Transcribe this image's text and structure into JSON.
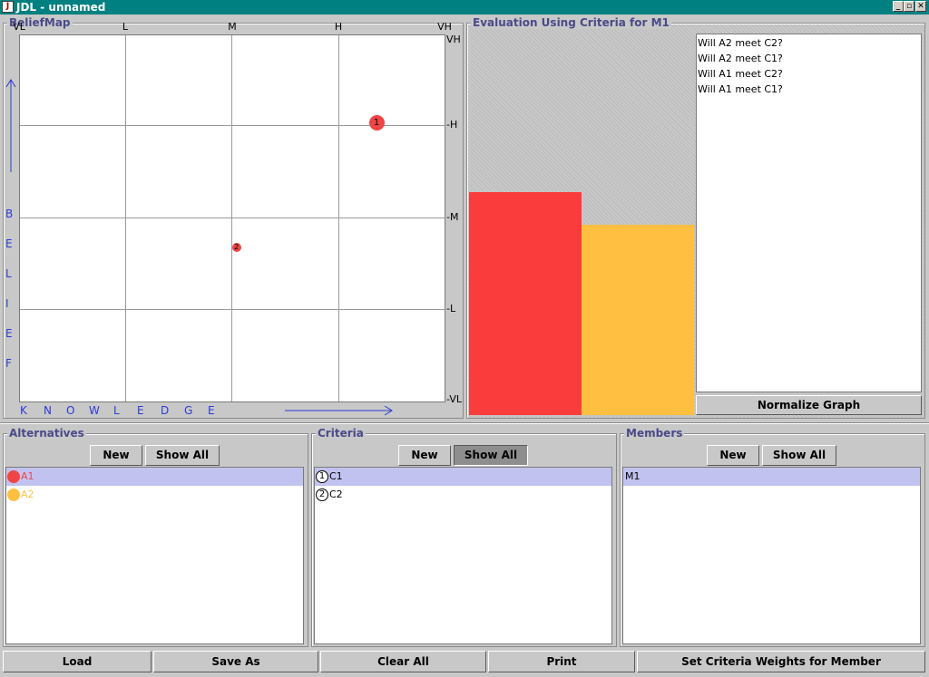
{
  "window": {
    "title": "JDL - unnamed",
    "app_icon": "duke-icon",
    "minimize": "_",
    "restore": "▫",
    "close": "✕"
  },
  "beliefmap": {
    "title": "BeliefMap",
    "top_ticks": [
      "VL",
      "L",
      "M",
      "H",
      "VH"
    ],
    "right_ticks": [
      "VH",
      "-H",
      "-M",
      "-L",
      "-VL"
    ],
    "belief_label": [
      "B",
      "E",
      "L",
      "I",
      "E",
      "F"
    ],
    "knowledge_label": [
      "K",
      "N",
      "O",
      "W",
      "L",
      "E",
      "D",
      "G",
      "E"
    ],
    "points": [
      {
        "label": "1",
        "knowledge": 0.84,
        "belief": 0.76,
        "size": "large"
      },
      {
        "label": "2",
        "knowledge": 0.51,
        "belief": 0.42,
        "size": "small"
      }
    ]
  },
  "evaluation": {
    "title": "Evaluation Using Criteria for M1",
    "bars": [
      {
        "value": 0.585,
        "color": "#fa3c3c"
      },
      {
        "value": 0.5,
        "color": "#ffbf40"
      }
    ],
    "questions": [
      "Will A2 meet C2?",
      "Will A2 meet C1?",
      "Will A1 meet C2?",
      "Will A1 meet C1?"
    ],
    "normalize_label": "Normalize Graph"
  },
  "alternatives": {
    "title": "Alternatives",
    "new_label": "New",
    "show_all_label": "Show All",
    "items": [
      {
        "label": "A1",
        "color": "#f04545"
      },
      {
        "label": "A2",
        "color": "#ffbf40"
      }
    ]
  },
  "criteria": {
    "title": "Criteria",
    "new_label": "New",
    "show_all_label": "Show All",
    "items": [
      {
        "number": "1",
        "label": "C1"
      },
      {
        "number": "2",
        "label": "C2"
      }
    ]
  },
  "members": {
    "title": "Members",
    "new_label": "New",
    "show_all_label": "Show All",
    "items": [
      {
        "label": "M1"
      }
    ]
  },
  "bottom_buttons": {
    "load": "Load",
    "save_as": "Save As",
    "clear_all": "Clear All",
    "print": "Print",
    "set_weights": "Set Criteria Weights for Member"
  }
}
